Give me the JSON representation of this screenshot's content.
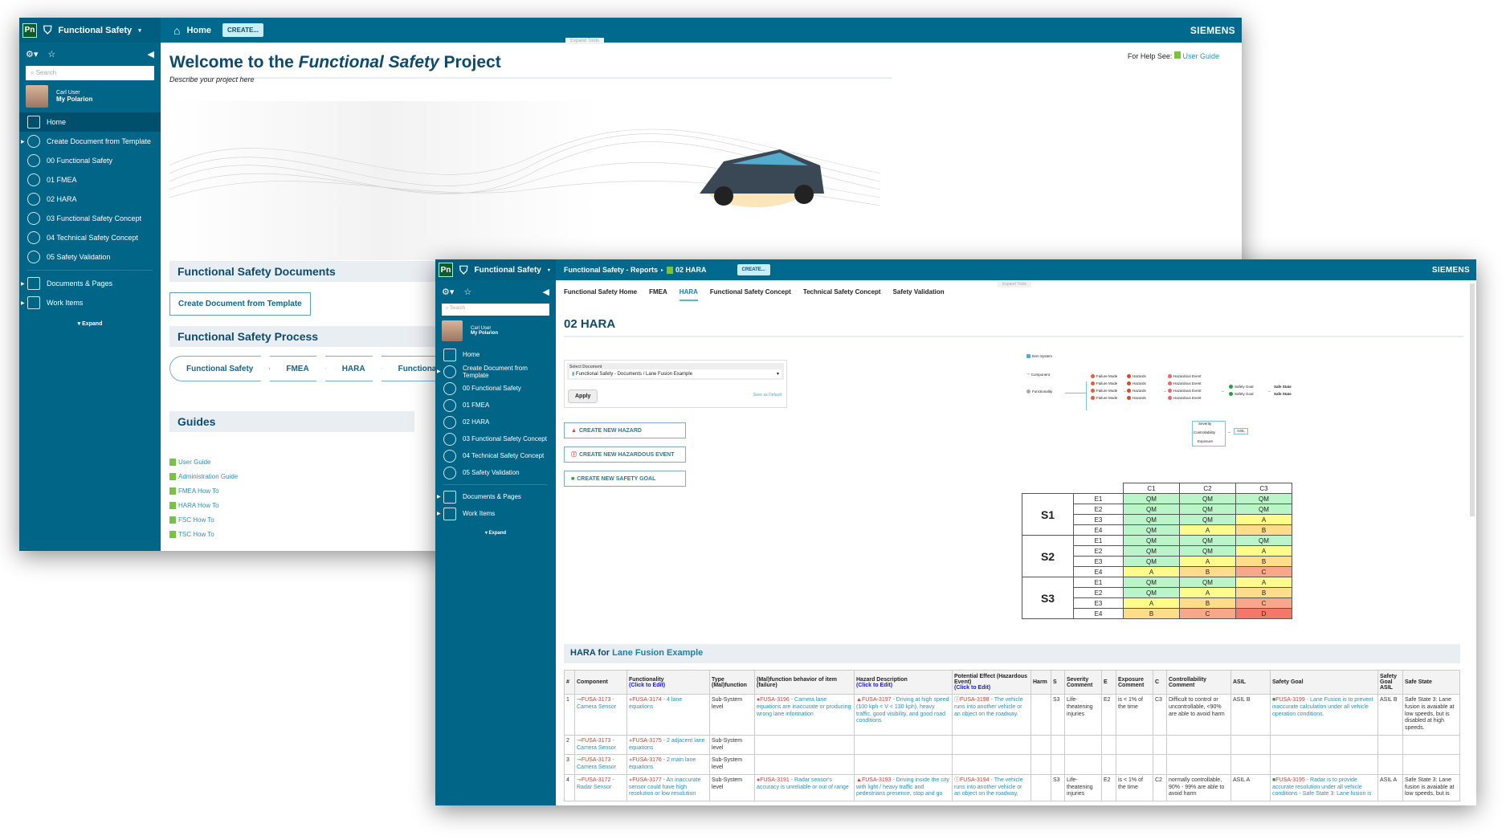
{
  "back_window": {
    "header": {
      "logo": "Pn",
      "project": "Functional Safety",
      "home_label": "Home",
      "create_label": "CREATE...",
      "brand": "SIEMENS"
    },
    "sidebar": {
      "search_placeholder": "Search",
      "user_name": "Carl User",
      "user_link": "My Polarion",
      "items": [
        {
          "label": "Home",
          "icon": "home-icon"
        },
        {
          "label": "Create Document from Template",
          "icon": "target-icon"
        },
        {
          "label": "00 Functional Safety",
          "icon": "target-icon"
        },
        {
          "label": "01 FMEA",
          "icon": "target-icon"
        },
        {
          "label": "02 HARA",
          "icon": "target-icon"
        },
        {
          "label": "03 Functional Safety Concept",
          "icon": "target-icon"
        },
        {
          "label": "04 Technical Safety Concept",
          "icon": "target-icon"
        },
        {
          "label": "05 Safety Validation",
          "icon": "target-icon"
        }
      ],
      "sections": [
        {
          "label": "Documents & Pages"
        },
        {
          "label": "Work Items"
        }
      ],
      "expand_label": "Expand"
    },
    "main": {
      "expand_tools": "Expand Tools",
      "title_prefix": "Welcome to the ",
      "title_em": "Functional Safety",
      "title_suffix": " Project",
      "description": "Describe your project here",
      "help_label": "For Help See:",
      "help_link": "User Guide",
      "documents_heading": "Functional Safety Documents",
      "create_doc_button": "Create Document from Template",
      "process_heading": "Functional Safety Process",
      "process_steps": [
        "Functional Safety",
        "FMEA",
        "HARA",
        "Functional Safety Concept"
      ],
      "guides_heading": "Guides",
      "guides": [
        "User Guide",
        "Administration Guide",
        "FMEA How To",
        "HARA How To",
        "FSC How To",
        "TSC How To"
      ]
    }
  },
  "front_window": {
    "header": {
      "logo": "Pn",
      "project": "Functional Safety",
      "breadcrumb_parent": "Functional Safety - Reports",
      "breadcrumb_current": "02 HARA",
      "create_label": "CREATE...",
      "brand": "SIEMENS"
    },
    "sidebar": {
      "search_placeholder": "Search",
      "user_name": "Carl User",
      "user_link": "My Polarion",
      "items": [
        {
          "label": "Home"
        },
        {
          "label": "Create Document from Template"
        },
        {
          "label": "00 Functional Safety"
        },
        {
          "label": "01 FMEA"
        },
        {
          "label": "02 HARA"
        },
        {
          "label": "03 Functional Safety Concept"
        },
        {
          "label": "04 Technical Safety Concept"
        },
        {
          "label": "05 Safety Validation"
        }
      ],
      "sections": [
        {
          "label": "Documents & Pages"
        },
        {
          "label": "Work Items"
        }
      ],
      "expand_label": "Expand"
    },
    "main": {
      "expand_tools": "Expand Tools",
      "tabs": [
        "Functional Safety Home",
        "FMEA",
        "HARA",
        "Functional Safety Concept",
        "Technical Safety Concept",
        "Safety Validation"
      ],
      "active_tab": "HARA",
      "title": "02 HARA",
      "select_label": "Select Document",
      "select_value": "Functional Safety - Documents / Lane Fusion Example",
      "apply_label": "Apply",
      "save_default_label": "Save as Default",
      "buttons": [
        "CREATE NEW HAZARD",
        "CREATE NEW HAZARDOUS EVENT",
        "CREATE NEW SAFETY GOAL"
      ],
      "diagram": {
        "item_system": "Item System",
        "component": "Component",
        "functionality": "Functionality",
        "failure_modes": [
          "Failure Mode",
          "Failure Mode",
          "Failure Mode",
          "Failure Mode"
        ],
        "hazards": [
          "Hazards",
          "Hazards",
          "Hazards",
          "Hazards"
        ],
        "hazardous_events": [
          "Hazardous Event",
          "Hazardous Event",
          "Hazardous Event",
          "Hazardous Event"
        ],
        "safety_goals": [
          "Safety Goal",
          "Safety Goal"
        ],
        "safe_states": [
          "Safe State",
          "Safe State"
        ],
        "factors": [
          "Severity",
          "Controllability",
          "Exposure"
        ],
        "asil": "ASIL"
      },
      "asil_matrix": {
        "columns": [
          "C1",
          "C2",
          "C3"
        ],
        "groups": [
          {
            "s": "S1",
            "rows": [
              {
                "e": "E1",
                "v": [
                  "QM",
                  "QM",
                  "QM"
                ]
              },
              {
                "e": "E2",
                "v": [
                  "QM",
                  "QM",
                  "QM"
                ]
              },
              {
                "e": "E3",
                "v": [
                  "QM",
                  "QM",
                  "A"
                ]
              },
              {
                "e": "E4",
                "v": [
                  "QM",
                  "A",
                  "B"
                ]
              }
            ]
          },
          {
            "s": "S2",
            "rows": [
              {
                "e": "E1",
                "v": [
                  "QM",
                  "QM",
                  "QM"
                ]
              },
              {
                "e": "E2",
                "v": [
                  "QM",
                  "QM",
                  "A"
                ]
              },
              {
                "e": "E3",
                "v": [
                  "QM",
                  "A",
                  "B"
                ]
              },
              {
                "e": "E4",
                "v": [
                  "A",
                  "B",
                  "C"
                ]
              }
            ]
          },
          {
            "s": "S3",
            "rows": [
              {
                "e": "E1",
                "v": [
                  "QM",
                  "QM",
                  "A"
                ]
              },
              {
                "e": "E2",
                "v": [
                  "QM",
                  "A",
                  "B"
                ]
              },
              {
                "e": "E3",
                "v": [
                  "A",
                  "B",
                  "C"
                ]
              },
              {
                "e": "E4",
                "v": [
                  "B",
                  "C",
                  "D"
                ]
              }
            ]
          }
        ],
        "colors": {
          "QM": "#b9f5c8",
          "A": "#fdfb8c",
          "B": "#fddc8a",
          "C": "#f7a88a",
          "D": "#f4786a"
        }
      },
      "hara_heading_prefix": "HARA for ",
      "hara_heading_doc": "Lane Fusion Example",
      "table": {
        "columns": [
          {
            "label": "#"
          },
          {
            "label": "Component"
          },
          {
            "label": "Functionality",
            "edit": "(Click to Edit)"
          },
          {
            "label": "Type (Mal)function"
          },
          {
            "label": "(Mal)function behavior of item (failure)"
          },
          {
            "label": "Hazard Description",
            "edit": "(Click to Edit)"
          },
          {
            "label": "Potential Effect (Hazardous Event)",
            "edit": "(Click to Edit)"
          },
          {
            "label": "Harm"
          },
          {
            "label": "S"
          },
          {
            "label": "Severity Comment"
          },
          {
            "label": "E"
          },
          {
            "label": "Exposure Comment"
          },
          {
            "label": "C"
          },
          {
            "label": "Controllability Comment"
          },
          {
            "label": "ASIL"
          },
          {
            "label": "Safety Goal"
          },
          {
            "label": "Safety Goal ASIL"
          },
          {
            "label": "Safe State"
          }
        ],
        "rows": [
          [
            "1",
            {
              "id": "FUSA-3173",
              "t": "Camera Sensor"
            },
            {
              "id": "FUSA-3174",
              "t": "4 lane equations"
            },
            "Sub-System level",
            {
              "id": "FUSA-3196",
              "t": "Camera lane equations are inaccurate or producing wrong lane information"
            },
            {
              "id": "FUSA-3197",
              "t": "Driving at high speed (100 kph < V < 130 kph), heavy traffic, good visibility, and good road conditions"
            },
            {
              "id": "FUSA-3198",
              "t": "The vehicle runs into another vehicle or an object on the roadway."
            },
            "",
            "S3",
            "Life-theatening injuries",
            "E2",
            "is < 1% of the time",
            "C3",
            "Difficult to control or uncontrollable, <90% are able to avoid harm",
            "ASIL B",
            {
              "id": "FUSA-3199",
              "t": "Lane Fusion is to prevent inaccurate calculation under all vehicle operation conditions."
            },
            "ASIL B",
            "Safe State 3: Lane fusion is avaiable at low speeds, but is disabled at high speeds."
          ],
          [
            "2",
            {
              "id": "FUSA-3173",
              "t": "Camera Sensor"
            },
            {
              "id": "FUSA-3175",
              "t": "2 adjacent lane equations"
            },
            "Sub-System level",
            "",
            "",
            "",
            "",
            "",
            "",
            "",
            "",
            "",
            "",
            "",
            "",
            "",
            ""
          ],
          [
            "3",
            {
              "id": "FUSA-3173",
              "t": "Camera Sensor"
            },
            {
              "id": "FUSA-3176",
              "t": "2 main lane equations"
            },
            "Sub-System level",
            "",
            "",
            "",
            "",
            "",
            "",
            "",
            "",
            "",
            "",
            "",
            "",
            "",
            ""
          ],
          [
            "4",
            {
              "id": "FUSA-3172",
              "t": "Radar Sensor"
            },
            {
              "id": "FUSA-3177",
              "t": "An inaccurate sensor could have high resolution or low resolution"
            },
            "Sub-System level",
            {
              "id": "FUSA-3191",
              "t": "Radar sensor's accuracy is unreliable or out of range"
            },
            {
              "id": "FUSA-3193",
              "t": "Driving inside the city with light / heavy traffic and pedestrians presence, stop and go"
            },
            {
              "id": "FUSA-3194",
              "t": "The vehicle runs into another vehicle or an object on the roadway."
            },
            "",
            "S3",
            "Life-theatening injuries",
            "E2",
            "is < 1% of the time",
            "C2",
            "normally controllable, 90% - 99% are able to avoid harm",
            "ASIL A",
            {
              "id": "FUSA-3195",
              "t": "Radar is to provide accurate resolution under all vehicle conditions - Safe State 3: Lane fusion is"
            },
            "ASIL A",
            "Safe State 3: Lane fusion is avaiable at low speeds, but is"
          ]
        ]
      }
    }
  }
}
